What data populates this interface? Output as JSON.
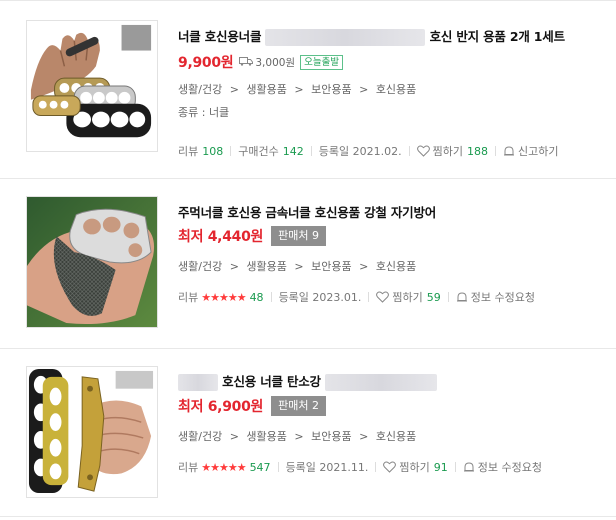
{
  "products": [
    {
      "title_prefix": "너클 호신용너클",
      "title_suffix": "호신 반지 용품 2개 1세트",
      "price": "9,900원",
      "shipping": "3,000원",
      "today_badge": "오늘출발",
      "category": [
        "생활/건강",
        "생활용품",
        "보안용품",
        "호신용품"
      ],
      "kind": "종류 : 너클",
      "review_label": "리뷰",
      "review_count": "108",
      "purchase_label": "구매건수",
      "purchase_count": "142",
      "date": "등록일 2021.02.",
      "wish_label": "찜하기",
      "wish_count": "188",
      "report_label": "신고하기"
    },
    {
      "title": "주먹너클 호신용 금속너클 호신용품 강철 자기방어",
      "price": "최저 4,440원",
      "seller_badge": "판매처 9",
      "category": [
        "생활/건강",
        "생활용품",
        "보안용품",
        "호신용품"
      ],
      "review_label": "리뷰",
      "stars": "★★★★★",
      "review_count": "48",
      "date": "등록일 2023.01.",
      "wish_label": "찜하기",
      "wish_count": "59",
      "edit_label": "정보 수정요청"
    },
    {
      "title_middle": "호신용 너클 탄소강",
      "price": "최저 6,900원",
      "seller_badge": "판매처 2",
      "category": [
        "생활/건강",
        "생활용품",
        "보안용품",
        "호신용품"
      ],
      "review_label": "리뷰",
      "stars": "★★★★★",
      "review_count": "547",
      "date": "등록일 2021.11.",
      "wish_label": "찜하기",
      "wish_count": "91",
      "edit_label": "정보 수정요청"
    }
  ],
  "category_separator": ">"
}
